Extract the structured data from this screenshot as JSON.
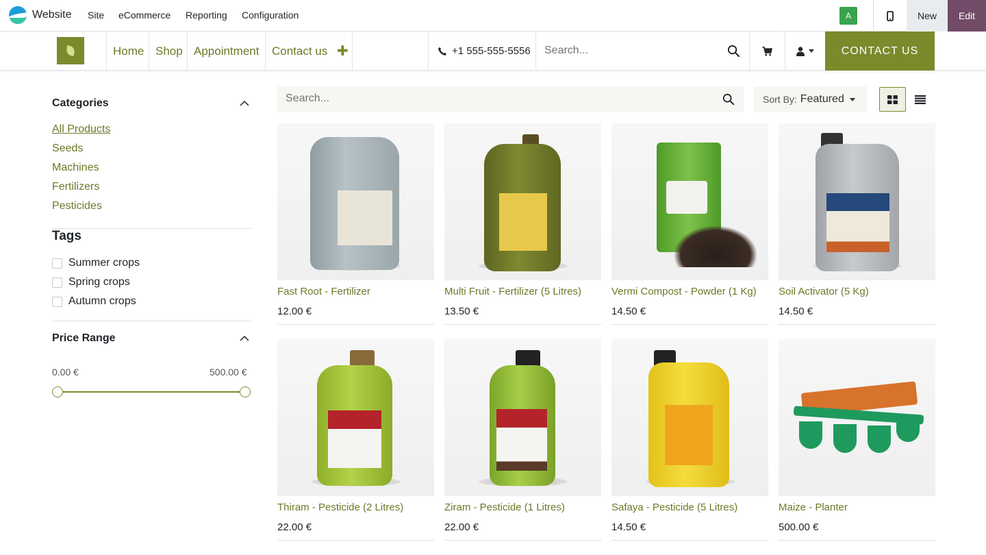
{
  "admin": {
    "title": "Website",
    "menu": [
      "Site",
      "eCommerce",
      "Reporting",
      "Configuration"
    ],
    "avatar": "A",
    "new_label": "New",
    "edit_label": "Edit"
  },
  "header": {
    "nav": [
      "Home",
      "Shop",
      "Appointment",
      "Contact us"
    ],
    "phone": "+1 555-555-5556",
    "search_placeholder": "Search...",
    "contact_button": "CONTACT US"
  },
  "sidebar": {
    "categories_title": "Categories",
    "categories": [
      "All Products",
      "Seeds",
      "Machines",
      "Fertilizers",
      "Pesticides"
    ],
    "tags_title": "Tags",
    "tags": [
      "Summer crops",
      "Spring crops",
      "Autumn crops"
    ],
    "price_title": "Price Range",
    "price_min": "0.00 €",
    "price_max": "500.00 €"
  },
  "main": {
    "search_placeholder": "Search...",
    "sort_label": "Sort By:",
    "sort_value": "Featured"
  },
  "products": [
    {
      "name": "Fast Root - Fertilizer",
      "price": "12.00 €"
    },
    {
      "name": "Multi Fruit - Fertilizer (5 Litres)",
      "price": "13.50 €"
    },
    {
      "name": "Vermi Compost - Powder (1 Kg)",
      "price": "14.50 €"
    },
    {
      "name": "Soil Activator (5 Kg)",
      "price": "14.50 €"
    },
    {
      "name": "Thiram - Pesticide (2 Litres)",
      "price": "22.00 €"
    },
    {
      "name": "Ziram - Pesticide (1 Litres)",
      "price": "22.00 €"
    },
    {
      "name": "Safaya - Pesticide (5 Litres)",
      "price": "14.50 €"
    },
    {
      "name": "Maize - Planter",
      "price": "500.00 €"
    }
  ],
  "icons": {
    "logo": "odoo-logo-icon",
    "mobile": "mobile-phone-icon",
    "phone": "phone-icon",
    "search": "search-icon",
    "cart": "cart-icon",
    "user": "user-icon",
    "grid": "grid-view-icon",
    "list": "list-view-icon",
    "collapse": "chevron-up-icon"
  },
  "colors": {
    "brand": "#7c8a2c",
    "edit": "#714b67",
    "link": "#6b7a28"
  }
}
